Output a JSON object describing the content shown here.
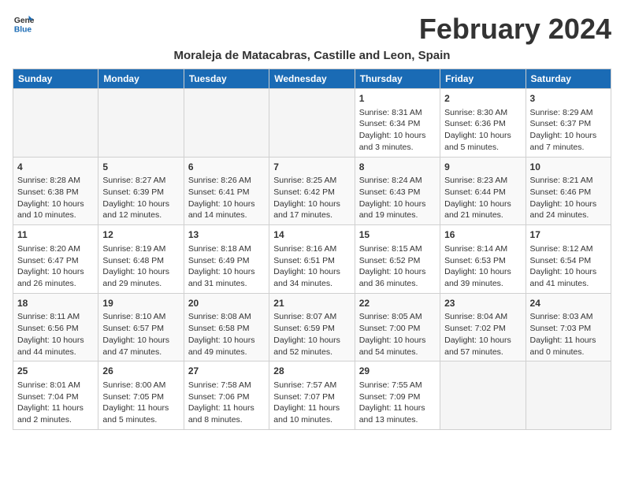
{
  "logo": {
    "line1": "General",
    "line2": "Blue",
    "icon_color": "#1a6bb5"
  },
  "title": "February 2024",
  "subtitle": "Moraleja de Matacabras, Castille and Leon, Spain",
  "header_color": "#1a6bb5",
  "days_of_week": [
    "Sunday",
    "Monday",
    "Tuesday",
    "Wednesday",
    "Thursday",
    "Friday",
    "Saturday"
  ],
  "weeks": [
    [
      {
        "day": "",
        "info": ""
      },
      {
        "day": "",
        "info": ""
      },
      {
        "day": "",
        "info": ""
      },
      {
        "day": "",
        "info": ""
      },
      {
        "day": "1",
        "info": "Sunrise: 8:31 AM\nSunset: 6:34 PM\nDaylight: 10 hours\nand 3 minutes."
      },
      {
        "day": "2",
        "info": "Sunrise: 8:30 AM\nSunset: 6:36 PM\nDaylight: 10 hours\nand 5 minutes."
      },
      {
        "day": "3",
        "info": "Sunrise: 8:29 AM\nSunset: 6:37 PM\nDaylight: 10 hours\nand 7 minutes."
      }
    ],
    [
      {
        "day": "4",
        "info": "Sunrise: 8:28 AM\nSunset: 6:38 PM\nDaylight: 10 hours\nand 10 minutes."
      },
      {
        "day": "5",
        "info": "Sunrise: 8:27 AM\nSunset: 6:39 PM\nDaylight: 10 hours\nand 12 minutes."
      },
      {
        "day": "6",
        "info": "Sunrise: 8:26 AM\nSunset: 6:41 PM\nDaylight: 10 hours\nand 14 minutes."
      },
      {
        "day": "7",
        "info": "Sunrise: 8:25 AM\nSunset: 6:42 PM\nDaylight: 10 hours\nand 17 minutes."
      },
      {
        "day": "8",
        "info": "Sunrise: 8:24 AM\nSunset: 6:43 PM\nDaylight: 10 hours\nand 19 minutes."
      },
      {
        "day": "9",
        "info": "Sunrise: 8:23 AM\nSunset: 6:44 PM\nDaylight: 10 hours\nand 21 minutes."
      },
      {
        "day": "10",
        "info": "Sunrise: 8:21 AM\nSunset: 6:46 PM\nDaylight: 10 hours\nand 24 minutes."
      }
    ],
    [
      {
        "day": "11",
        "info": "Sunrise: 8:20 AM\nSunset: 6:47 PM\nDaylight: 10 hours\nand 26 minutes."
      },
      {
        "day": "12",
        "info": "Sunrise: 8:19 AM\nSunset: 6:48 PM\nDaylight: 10 hours\nand 29 minutes."
      },
      {
        "day": "13",
        "info": "Sunrise: 8:18 AM\nSunset: 6:49 PM\nDaylight: 10 hours\nand 31 minutes."
      },
      {
        "day": "14",
        "info": "Sunrise: 8:16 AM\nSunset: 6:51 PM\nDaylight: 10 hours\nand 34 minutes."
      },
      {
        "day": "15",
        "info": "Sunrise: 8:15 AM\nSunset: 6:52 PM\nDaylight: 10 hours\nand 36 minutes."
      },
      {
        "day": "16",
        "info": "Sunrise: 8:14 AM\nSunset: 6:53 PM\nDaylight: 10 hours\nand 39 minutes."
      },
      {
        "day": "17",
        "info": "Sunrise: 8:12 AM\nSunset: 6:54 PM\nDaylight: 10 hours\nand 41 minutes."
      }
    ],
    [
      {
        "day": "18",
        "info": "Sunrise: 8:11 AM\nSunset: 6:56 PM\nDaylight: 10 hours\nand 44 minutes."
      },
      {
        "day": "19",
        "info": "Sunrise: 8:10 AM\nSunset: 6:57 PM\nDaylight: 10 hours\nand 47 minutes."
      },
      {
        "day": "20",
        "info": "Sunrise: 8:08 AM\nSunset: 6:58 PM\nDaylight: 10 hours\nand 49 minutes."
      },
      {
        "day": "21",
        "info": "Sunrise: 8:07 AM\nSunset: 6:59 PM\nDaylight: 10 hours\nand 52 minutes."
      },
      {
        "day": "22",
        "info": "Sunrise: 8:05 AM\nSunset: 7:00 PM\nDaylight: 10 hours\nand 54 minutes."
      },
      {
        "day": "23",
        "info": "Sunrise: 8:04 AM\nSunset: 7:02 PM\nDaylight: 10 hours\nand 57 minutes."
      },
      {
        "day": "24",
        "info": "Sunrise: 8:03 AM\nSunset: 7:03 PM\nDaylight: 11 hours\nand 0 minutes."
      }
    ],
    [
      {
        "day": "25",
        "info": "Sunrise: 8:01 AM\nSunset: 7:04 PM\nDaylight: 11 hours\nand 2 minutes."
      },
      {
        "day": "26",
        "info": "Sunrise: 8:00 AM\nSunset: 7:05 PM\nDaylight: 11 hours\nand 5 minutes."
      },
      {
        "day": "27",
        "info": "Sunrise: 7:58 AM\nSunset: 7:06 PM\nDaylight: 11 hours\nand 8 minutes."
      },
      {
        "day": "28",
        "info": "Sunrise: 7:57 AM\nSunset: 7:07 PM\nDaylight: 11 hours\nand 10 minutes."
      },
      {
        "day": "29",
        "info": "Sunrise: 7:55 AM\nSunset: 7:09 PM\nDaylight: 11 hours\nand 13 minutes."
      },
      {
        "day": "",
        "info": ""
      },
      {
        "day": "",
        "info": ""
      }
    ]
  ]
}
